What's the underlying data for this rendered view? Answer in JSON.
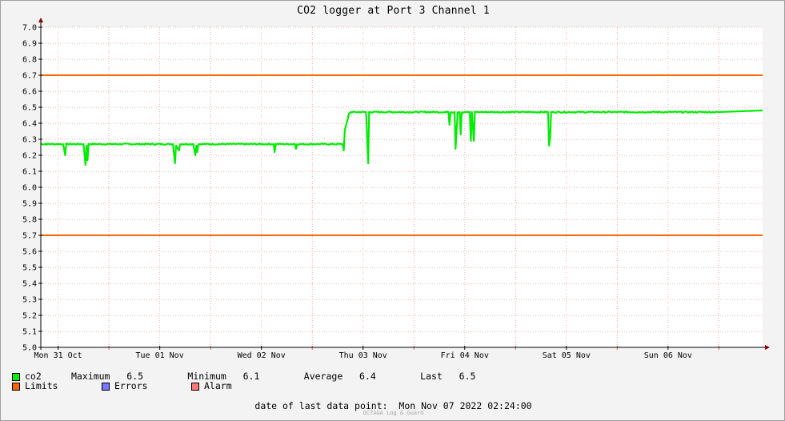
{
  "chart_data": {
    "type": "line",
    "title": "CO2 logger at Port 3 Channel 1",
    "y_ticks": [
      "7.0",
      "6.9",
      "6.8",
      "6.7",
      "6.6",
      "6.5",
      "6.4",
      "6.3",
      "6.2",
      "6.1",
      "6.0",
      "5.9",
      "5.8",
      "5.7",
      "5.6",
      "5.5",
      "5.4",
      "5.3",
      "5.2",
      "5.1",
      "5.0"
    ],
    "ylim": [
      5.0,
      7.0
    ],
    "x_tick_labels": [
      "Mon 31 Oct",
      "Tue 01 Nov",
      "Wed 02 Nov",
      "Thu 03 Nov",
      "Fri 04 Nov",
      "Sat 05 Nov",
      "Sun 06 Nov"
    ],
    "xlim_days": [
      -0.17,
      6.93
    ],
    "limits": [
      6.7,
      5.7
    ],
    "grid": true,
    "colors": {
      "co2": "#00ee00",
      "limits": "#ff6600",
      "errors": "#7777ff",
      "alarm": "#ff7777",
      "grid": "#e8a0a0",
      "axis": "#8b0000"
    },
    "series": [
      {
        "name": "co2",
        "points": [
          [
            -0.17,
            6.27
          ],
          [
            0.05,
            6.27
          ],
          [
            0.07,
            6.2
          ],
          [
            0.08,
            6.27
          ],
          [
            0.25,
            6.27
          ],
          [
            0.27,
            6.14
          ],
          [
            0.28,
            6.26
          ],
          [
            0.29,
            6.17
          ],
          [
            0.3,
            6.27
          ],
          [
            0.6,
            6.27
          ],
          [
            1.0,
            6.27
          ],
          [
            1.13,
            6.27
          ],
          [
            1.15,
            6.15
          ],
          [
            1.16,
            6.26
          ],
          [
            1.19,
            6.23
          ],
          [
            1.2,
            6.27
          ],
          [
            1.33,
            6.27
          ],
          [
            1.35,
            6.2
          ],
          [
            1.36,
            6.26
          ],
          [
            1.37,
            6.22
          ],
          [
            1.38,
            6.27
          ],
          [
            2.0,
            6.27
          ],
          [
            2.12,
            6.27
          ],
          [
            2.13,
            6.22
          ],
          [
            2.14,
            6.27
          ],
          [
            2.33,
            6.27
          ],
          [
            2.34,
            6.24
          ],
          [
            2.35,
            6.27
          ],
          [
            2.8,
            6.27
          ],
          [
            2.81,
            6.23
          ],
          [
            2.82,
            6.36
          ],
          [
            2.83,
            6.38
          ],
          [
            2.85,
            6.43
          ],
          [
            2.86,
            6.46
          ],
          [
            2.88,
            6.47
          ],
          [
            3.03,
            6.47
          ],
          [
            3.05,
            6.15
          ],
          [
            3.06,
            6.47
          ],
          [
            3.0,
            6.47
          ],
          [
            3.5,
            6.47
          ],
          [
            3.84,
            6.47
          ],
          [
            3.85,
            6.39
          ],
          [
            3.86,
            6.47
          ],
          [
            3.9,
            6.47
          ],
          [
            3.91,
            6.24
          ],
          [
            3.93,
            6.47
          ],
          [
            3.95,
            6.47
          ],
          [
            3.96,
            6.33
          ],
          [
            3.97,
            6.47
          ],
          [
            4.05,
            6.47
          ],
          [
            4.06,
            6.29
          ],
          [
            4.07,
            6.47
          ],
          [
            4.09,
            6.29
          ],
          [
            4.1,
            6.47
          ],
          [
            4.5,
            6.47
          ],
          [
            4.82,
            6.47
          ],
          [
            4.83,
            6.26
          ],
          [
            4.84,
            6.31
          ],
          [
            4.85,
            6.47
          ],
          [
            5.5,
            6.47
          ],
          [
            6.0,
            6.47
          ],
          [
            6.5,
            6.47
          ],
          [
            6.93,
            6.48
          ]
        ]
      }
    ]
  },
  "legend": {
    "co2": {
      "label": "co2",
      "stats": "Maximum   6.5        Minimum   6.1        Average   6.4        Last   6.5"
    },
    "limits": "Limits",
    "errors": "Errors",
    "alarm": "Alarm"
  },
  "footer": {
    "date_label": "date of last data point:",
    "date_value": "Mon Nov 07 2022 02:24:00",
    "brand": "OCTA&A Log & Guard"
  }
}
